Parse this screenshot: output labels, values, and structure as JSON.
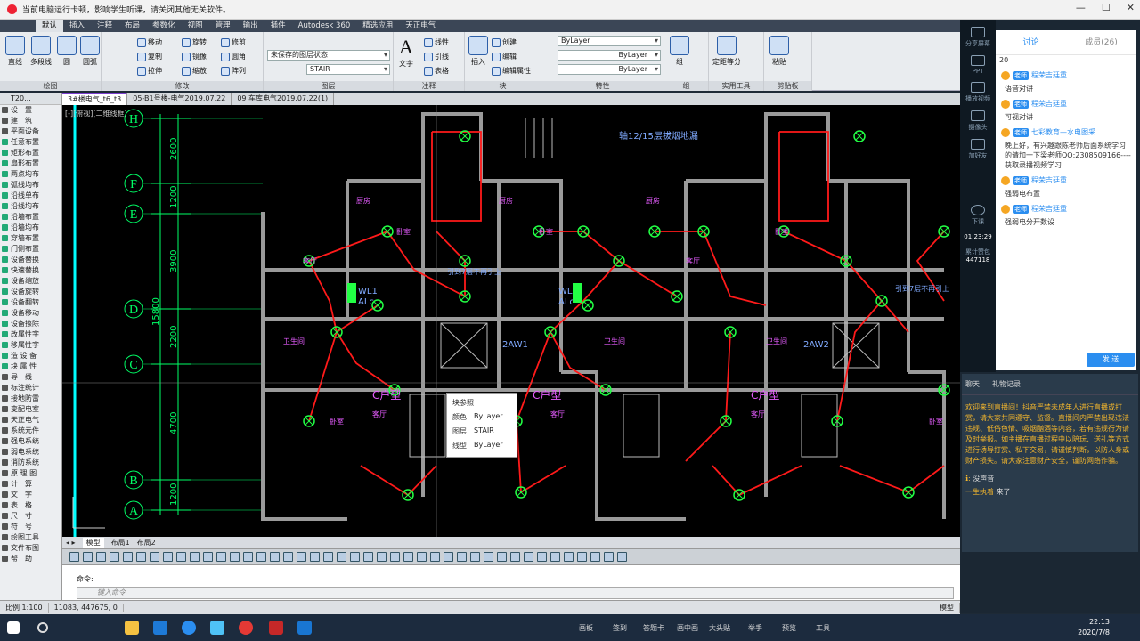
{
  "notice": {
    "text": "当前电脑运行卡顿，影响学生听课，请关闭其他无关软件。"
  },
  "menu_tabs": [
    "默认",
    "插入",
    "注释",
    "布局",
    "参数化",
    "视图",
    "管理",
    "输出",
    "插件",
    "Autodesk 360",
    "精选应用",
    "天正电气"
  ],
  "ribbon": {
    "draw": {
      "label": "绘图",
      "items": [
        "直线",
        "多段线",
        "圆",
        "圆弧"
      ]
    },
    "modify": {
      "label": "修改",
      "items": [
        "移动",
        "旋转",
        "修剪",
        "复制",
        "镜像",
        "圆角",
        "拉伸",
        "缩放",
        "阵列"
      ]
    },
    "layers": {
      "label": "图层",
      "state": "未保存的图层状态",
      "current": "STAIR"
    },
    "annotation": {
      "label": "注释",
      "text_btn": "文字",
      "items": [
        "线性",
        "引线",
        "表格"
      ]
    },
    "block": {
      "label": "块",
      "insert": "插入",
      "items": [
        "创建",
        "编辑",
        "编辑属性"
      ]
    },
    "properties": {
      "label": "特性",
      "color": "ByLayer",
      "linetype": "ByLayer",
      "lineweight": "ByLayer"
    },
    "group": {
      "label": "组",
      "item": "组"
    },
    "utilities": {
      "label": "实用工具",
      "item": "定距等分"
    },
    "clipboard": {
      "label": "剪贴板",
      "item": "粘贴"
    }
  },
  "doc_tabs": [
    "3#楼电气_t6_t3",
    "05-B1号楼-电气2019.07.22",
    "09 车库电气2019.07.22(1)"
  ],
  "palette": {
    "header": "T20...",
    "items": [
      "设　置",
      "建　筑",
      "平面设备",
      "任意布置",
      "矩形布置",
      "扇形布置",
      "两点均布",
      "弧线均布",
      "沿线单布",
      "沿线均布",
      "沿墙布置",
      "沿墙均布",
      "穿墙布置",
      "门侧布置",
      "设备替换",
      "快速替换",
      "设备缩放",
      "设备旋转",
      "设备翻转",
      "设备移动",
      "设备擦除",
      "改属性字",
      "移属性字",
      "造 设 备",
      "块 属 性",
      "导　线",
      "标注统计",
      "接地防雷",
      "变配电室",
      "天正电气",
      "系统元件",
      "强电系统",
      "弱电系统",
      "消防系统",
      "原 理 图",
      "计　算",
      "文　字",
      "表　格",
      "尺　寸",
      "符　号",
      "绘图工具",
      "文件布图",
      "帮　助"
    ]
  },
  "view_label": "[-][俯视][二维线框]",
  "drawing": {
    "axes": [
      "H",
      "F",
      "E",
      "D",
      "C",
      "B",
      "A"
    ],
    "dims": [
      "2600",
      "1200",
      "3900",
      "2200",
      "4700",
      "1200"
    ],
    "total_dim": "15800",
    "note": "轴12/15层拔烟地漏",
    "wl1_a": "WL1",
    "wl1_b": "WL1",
    "alc_a": "ALc",
    "alc_b": "ALc",
    "aw_a": "2AW1",
    "aw_b": "2AW2",
    "warn_a": "引到7层不再引上",
    "warn_b": "引到7层不再引上",
    "type_a": "C户型",
    "type_b": "C户型",
    "type_c": "C户型",
    "room_kitchen": "厨房",
    "room_living": "客厅",
    "room_bath": "卫生间",
    "room_bed": "卧室"
  },
  "tooltip": {
    "title": "块参照",
    "rows": [
      {
        "k": "颜色",
        "v": "ByLayer"
      },
      {
        "k": "图层",
        "v": "STAIR"
      },
      {
        "k": "线型",
        "v": "ByLayer"
      }
    ]
  },
  "layout_tabs": [
    "模型",
    "布局1",
    "布局2"
  ],
  "command": {
    "label": "命令:",
    "placeholder": "键入命令"
  },
  "status": {
    "scale": "比例 1:100",
    "coords": "11083, 447675, 0",
    "model": "模型"
  },
  "right_panel": {
    "side_items": [
      "分享屏幕",
      "PPT",
      "播放视频",
      "摄像头",
      "加好友",
      "下课"
    ],
    "timer": "01:23:29",
    "stat": "累计赞包",
    "stat_num": "447118",
    "chat_tabs": [
      "讨论",
      "成员(26)"
    ],
    "first_line": "20",
    "messages": [
      {
        "who": "程荣吉廷重",
        "text": "语音对讲"
      },
      {
        "who": "程荣吉廷重",
        "text": "可视对讲"
      },
      {
        "who": "七彩教育—水电图采...",
        "text": "晚上好，有兴趣跟陈老师后面系统学习的请加一下梁老师QQ:2308509166----获取录播视频学习"
      },
      {
        "who": "程荣吉廷重",
        "text": "强弱电布置"
      },
      {
        "who": "程荣吉廷重",
        "text": "强弱电分开数设"
      }
    ],
    "badge": "老师",
    "send": "发 送"
  },
  "live_chat": {
    "tabs": [
      "聊天",
      "礼物记录"
    ],
    "notice": "欢迎来到直播间！抖音严禁未成年人进行直播或打赏，请大家共同遵守、监督。直播间内严禁出现违法违规、低俗色情、吸烟酗酒等内容，若有违规行为请及时举报。如主播在直播过程中以陪玩、送礼等方式进行诱导打赏、私下交易，请谨慎判断，以防人身或财产损失。请大家注意财产安全，谨防网络诈骗。",
    "comments": [
      {
        "u": "ℹ:",
        "t": "没声音"
      },
      {
        "u": "一生执着",
        "t": "来了"
      }
    ]
  },
  "taskbar": {
    "apps": [
      "画板",
      "签到",
      "答题卡",
      "画中画",
      "大头贴",
      "举手",
      "预览",
      "工具"
    ],
    "time": "22:13",
    "date": "2020/7/8"
  }
}
